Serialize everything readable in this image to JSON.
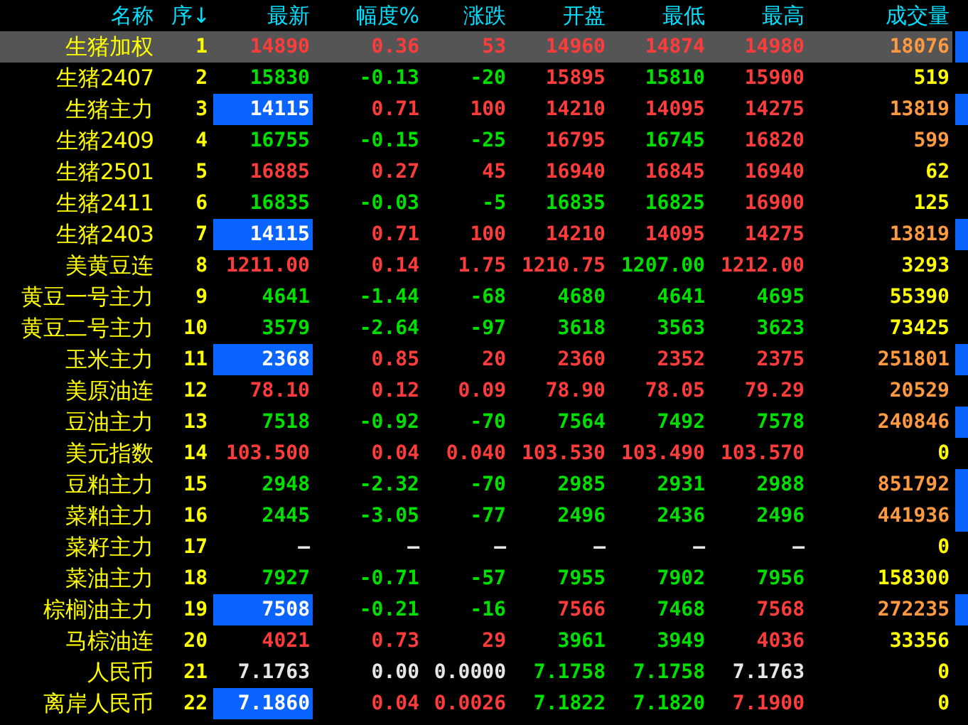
{
  "columns": [
    "名称",
    "序↓",
    "最新",
    "幅度%",
    "涨跌",
    "开盘",
    "最低",
    "最高",
    "成交量"
  ],
  "rows": [
    {
      "name": "生猪加权",
      "no": "1",
      "selected": true,
      "flash": false,
      "marker": true,
      "cells": [
        {
          "text": "14890",
          "color": "#ff3c3c"
        },
        {
          "text": "0.36",
          "color": "#ff3c3c"
        },
        {
          "text": "53",
          "color": "#ff3c3c"
        },
        {
          "text": "14960",
          "color": "#ff3c3c"
        },
        {
          "text": "14874",
          "color": "#ff3c3c"
        },
        {
          "text": "14980",
          "color": "#ff3c3c"
        }
      ],
      "volume": {
        "text": "18076",
        "color": "#ff9a40"
      }
    },
    {
      "name": "生猪2407",
      "no": "2",
      "selected": false,
      "flash": false,
      "marker": false,
      "cells": [
        {
          "text": "15830",
          "color": "#00e000"
        },
        {
          "text": "-0.13",
          "color": "#00e000"
        },
        {
          "text": "-20",
          "color": "#00e000"
        },
        {
          "text": "15895",
          "color": "#ff3c3c"
        },
        {
          "text": "15810",
          "color": "#00e000"
        },
        {
          "text": "15900",
          "color": "#ff3c3c"
        }
      ],
      "volume": {
        "text": "519",
        "color": "#ffff00"
      }
    },
    {
      "name": "生猪主力",
      "no": "3",
      "selected": false,
      "flash": true,
      "marker": true,
      "cells": [
        {
          "text": "14115",
          "color": "#ffffff"
        },
        {
          "text": "0.71",
          "color": "#ff3c3c"
        },
        {
          "text": "100",
          "color": "#ff3c3c"
        },
        {
          "text": "14210",
          "color": "#ff3c3c"
        },
        {
          "text": "14095",
          "color": "#ff3c3c"
        },
        {
          "text": "14275",
          "color": "#ff3c3c"
        }
      ],
      "volume": {
        "text": "13819",
        "color": "#ff9a40"
      }
    },
    {
      "name": "生猪2409",
      "no": "4",
      "selected": false,
      "flash": false,
      "marker": false,
      "cells": [
        {
          "text": "16755",
          "color": "#00e000"
        },
        {
          "text": "-0.15",
          "color": "#00e000"
        },
        {
          "text": "-25",
          "color": "#00e000"
        },
        {
          "text": "16795",
          "color": "#ff3c3c"
        },
        {
          "text": "16745",
          "color": "#00e000"
        },
        {
          "text": "16820",
          "color": "#ff3c3c"
        }
      ],
      "volume": {
        "text": "599",
        "color": "#ff9a40"
      }
    },
    {
      "name": "生猪2501",
      "no": "5",
      "selected": false,
      "flash": false,
      "marker": false,
      "cells": [
        {
          "text": "16885",
          "color": "#ff3c3c"
        },
        {
          "text": "0.27",
          "color": "#ff3c3c"
        },
        {
          "text": "45",
          "color": "#ff3c3c"
        },
        {
          "text": "16940",
          "color": "#ff3c3c"
        },
        {
          "text": "16845",
          "color": "#ff3c3c"
        },
        {
          "text": "16940",
          "color": "#ff3c3c"
        }
      ],
      "volume": {
        "text": "62",
        "color": "#ffff00"
      }
    },
    {
      "name": "生猪2411",
      "no": "6",
      "selected": false,
      "flash": false,
      "marker": false,
      "cells": [
        {
          "text": "16835",
          "color": "#00e000"
        },
        {
          "text": "-0.03",
          "color": "#00e000"
        },
        {
          "text": "-5",
          "color": "#00e000"
        },
        {
          "text": "16835",
          "color": "#00e000"
        },
        {
          "text": "16825",
          "color": "#00e000"
        },
        {
          "text": "16900",
          "color": "#ff3c3c"
        }
      ],
      "volume": {
        "text": "125",
        "color": "#ffff00"
      }
    },
    {
      "name": "生猪2403",
      "no": "7",
      "selected": false,
      "flash": true,
      "marker": true,
      "cells": [
        {
          "text": "14115",
          "color": "#ffffff"
        },
        {
          "text": "0.71",
          "color": "#ff3c3c"
        },
        {
          "text": "100",
          "color": "#ff3c3c"
        },
        {
          "text": "14210",
          "color": "#ff3c3c"
        },
        {
          "text": "14095",
          "color": "#ff3c3c"
        },
        {
          "text": "14275",
          "color": "#ff3c3c"
        }
      ],
      "volume": {
        "text": "13819",
        "color": "#ff9a40"
      }
    },
    {
      "name": "美黄豆连",
      "no": "8",
      "selected": false,
      "flash": false,
      "marker": false,
      "cells": [
        {
          "text": "1211.00",
          "color": "#ff3c3c"
        },
        {
          "text": "0.14",
          "color": "#ff3c3c"
        },
        {
          "text": "1.75",
          "color": "#ff3c3c"
        },
        {
          "text": "1210.75",
          "color": "#ff3c3c"
        },
        {
          "text": "1207.00",
          "color": "#00e000"
        },
        {
          "text": "1212.00",
          "color": "#ff3c3c"
        }
      ],
      "volume": {
        "text": "3293",
        "color": "#ffff00"
      }
    },
    {
      "name": "黄豆一号主力",
      "no": "9",
      "selected": false,
      "flash": false,
      "marker": false,
      "cells": [
        {
          "text": "4641",
          "color": "#00e000"
        },
        {
          "text": "-1.44",
          "color": "#00e000"
        },
        {
          "text": "-68",
          "color": "#00e000"
        },
        {
          "text": "4680",
          "color": "#00e000"
        },
        {
          "text": "4641",
          "color": "#00e000"
        },
        {
          "text": "4695",
          "color": "#00e000"
        }
      ],
      "volume": {
        "text": "55390",
        "color": "#ffff00"
      }
    },
    {
      "name": "黄豆二号主力",
      "no": "10",
      "selected": false,
      "flash": false,
      "marker": false,
      "cells": [
        {
          "text": "3579",
          "color": "#00e000"
        },
        {
          "text": "-2.64",
          "color": "#00e000"
        },
        {
          "text": "-97",
          "color": "#00e000"
        },
        {
          "text": "3618",
          "color": "#00e000"
        },
        {
          "text": "3563",
          "color": "#00e000"
        },
        {
          "text": "3623",
          "color": "#00e000"
        }
      ],
      "volume": {
        "text": "73425",
        "color": "#ffff00"
      }
    },
    {
      "name": "玉米主力",
      "no": "11",
      "selected": false,
      "flash": true,
      "marker": true,
      "cells": [
        {
          "text": "2368",
          "color": "#ffffff"
        },
        {
          "text": "0.85",
          "color": "#ff3c3c"
        },
        {
          "text": "20",
          "color": "#ff3c3c"
        },
        {
          "text": "2360",
          "color": "#ff3c3c"
        },
        {
          "text": "2352",
          "color": "#ff3c3c"
        },
        {
          "text": "2375",
          "color": "#ff3c3c"
        }
      ],
      "volume": {
        "text": "251801",
        "color": "#ff9a40"
      }
    },
    {
      "name": "美原油连",
      "no": "12",
      "selected": false,
      "flash": false,
      "marker": false,
      "cells": [
        {
          "text": "78.10",
          "color": "#ff3c3c"
        },
        {
          "text": "0.12",
          "color": "#ff3c3c"
        },
        {
          "text": "0.09",
          "color": "#ff3c3c"
        },
        {
          "text": "78.90",
          "color": "#ff3c3c"
        },
        {
          "text": "78.05",
          "color": "#ff3c3c"
        },
        {
          "text": "79.29",
          "color": "#ff3c3c"
        }
      ],
      "volume": {
        "text": "20529",
        "color": "#ff9a40"
      }
    },
    {
      "name": "豆油主力",
      "no": "13",
      "selected": false,
      "flash": false,
      "marker": true,
      "cells": [
        {
          "text": "7518",
          "color": "#00e000"
        },
        {
          "text": "-0.92",
          "color": "#00e000"
        },
        {
          "text": "-70",
          "color": "#00e000"
        },
        {
          "text": "7564",
          "color": "#00e000"
        },
        {
          "text": "7492",
          "color": "#00e000"
        },
        {
          "text": "7578",
          "color": "#00e000"
        }
      ],
      "volume": {
        "text": "240846",
        "color": "#ff9a40"
      }
    },
    {
      "name": "美元指数",
      "no": "14",
      "selected": false,
      "flash": false,
      "marker": false,
      "cells": [
        {
          "text": "103.500",
          "color": "#ff3c3c"
        },
        {
          "text": "0.04",
          "color": "#ff3c3c"
        },
        {
          "text": "0.040",
          "color": "#ff3c3c"
        },
        {
          "text": "103.530",
          "color": "#ff3c3c"
        },
        {
          "text": "103.490",
          "color": "#ff3c3c"
        },
        {
          "text": "103.570",
          "color": "#ff3c3c"
        }
      ],
      "volume": {
        "text": "0",
        "color": "#ffff00"
      }
    },
    {
      "name": "豆粕主力",
      "no": "15",
      "selected": false,
      "flash": false,
      "marker": true,
      "cells": [
        {
          "text": "2948",
          "color": "#00e000"
        },
        {
          "text": "-2.32",
          "color": "#00e000"
        },
        {
          "text": "-70",
          "color": "#00e000"
        },
        {
          "text": "2985",
          "color": "#00e000"
        },
        {
          "text": "2931",
          "color": "#00e000"
        },
        {
          "text": "2988",
          "color": "#00e000"
        }
      ],
      "volume": {
        "text": "851792",
        "color": "#ff9a40"
      }
    },
    {
      "name": "菜粕主力",
      "no": "16",
      "selected": false,
      "flash": false,
      "marker": true,
      "cells": [
        {
          "text": "2445",
          "color": "#00e000"
        },
        {
          "text": "-3.05",
          "color": "#00e000"
        },
        {
          "text": "-77",
          "color": "#00e000"
        },
        {
          "text": "2496",
          "color": "#00e000"
        },
        {
          "text": "2436",
          "color": "#00e000"
        },
        {
          "text": "2496",
          "color": "#00e000"
        }
      ],
      "volume": {
        "text": "441936",
        "color": "#ff9a40"
      }
    },
    {
      "name": "菜籽主力",
      "no": "17",
      "selected": false,
      "flash": false,
      "marker": false,
      "cells": [
        {
          "text": "—",
          "color": "#e6e6e6"
        },
        {
          "text": "—",
          "color": "#e6e6e6"
        },
        {
          "text": "—",
          "color": "#e6e6e6"
        },
        {
          "text": "—",
          "color": "#e6e6e6"
        },
        {
          "text": "—",
          "color": "#e6e6e6"
        },
        {
          "text": "—",
          "color": "#e6e6e6"
        }
      ],
      "volume": {
        "text": "0",
        "color": "#ffff00"
      }
    },
    {
      "name": "菜油主力",
      "no": "18",
      "selected": false,
      "flash": false,
      "marker": false,
      "cells": [
        {
          "text": "7927",
          "color": "#00e000"
        },
        {
          "text": "-0.71",
          "color": "#00e000"
        },
        {
          "text": "-57",
          "color": "#00e000"
        },
        {
          "text": "7955",
          "color": "#00e000"
        },
        {
          "text": "7902",
          "color": "#00e000"
        },
        {
          "text": "7956",
          "color": "#00e000"
        }
      ],
      "volume": {
        "text": "158300",
        "color": "#ffff00"
      }
    },
    {
      "name": "棕榈油主力",
      "no": "19",
      "selected": false,
      "flash": true,
      "marker": true,
      "cells": [
        {
          "text": "7508",
          "color": "#ffffff"
        },
        {
          "text": "-0.21",
          "color": "#00e000"
        },
        {
          "text": "-16",
          "color": "#00e000"
        },
        {
          "text": "7566",
          "color": "#ff3c3c"
        },
        {
          "text": "7468",
          "color": "#00e000"
        },
        {
          "text": "7568",
          "color": "#ff3c3c"
        }
      ],
      "volume": {
        "text": "272235",
        "color": "#ff9a40"
      }
    },
    {
      "name": "马棕油连",
      "no": "20",
      "selected": false,
      "flash": false,
      "marker": false,
      "cells": [
        {
          "text": "4021",
          "color": "#ff3c3c"
        },
        {
          "text": "0.73",
          "color": "#ff3c3c"
        },
        {
          "text": "29",
          "color": "#ff3c3c"
        },
        {
          "text": "3961",
          "color": "#00e000"
        },
        {
          "text": "3949",
          "color": "#00e000"
        },
        {
          "text": "4036",
          "color": "#ff3c3c"
        }
      ],
      "volume": {
        "text": "33356",
        "color": "#ffff00"
      }
    },
    {
      "name": "人民币",
      "no": "21",
      "selected": false,
      "flash": false,
      "marker": false,
      "cells": [
        {
          "text": "7.1763",
          "color": "#e6e6e6"
        },
        {
          "text": "0.00",
          "color": "#e6e6e6"
        },
        {
          "text": "0.0000",
          "color": "#e6e6e6"
        },
        {
          "text": "7.1758",
          "color": "#00e000"
        },
        {
          "text": "7.1758",
          "color": "#00e000"
        },
        {
          "text": "7.1763",
          "color": "#e6e6e6"
        }
      ],
      "volume": {
        "text": "0",
        "color": "#ffff00"
      }
    },
    {
      "name": "离岸人民币",
      "no": "22",
      "selected": false,
      "flash": true,
      "marker": false,
      "cells": [
        {
          "text": "7.1860",
          "color": "#ffffff"
        },
        {
          "text": "0.04",
          "color": "#ff3c3c"
        },
        {
          "text": "0.0026",
          "color": "#ff3c3c"
        },
        {
          "text": "7.1822",
          "color": "#00e000"
        },
        {
          "text": "7.1820",
          "color": "#00e000"
        },
        {
          "text": "7.1900",
          "color": "#ff3c3c"
        }
      ],
      "volume": {
        "text": "0",
        "color": "#ffff00"
      }
    }
  ]
}
